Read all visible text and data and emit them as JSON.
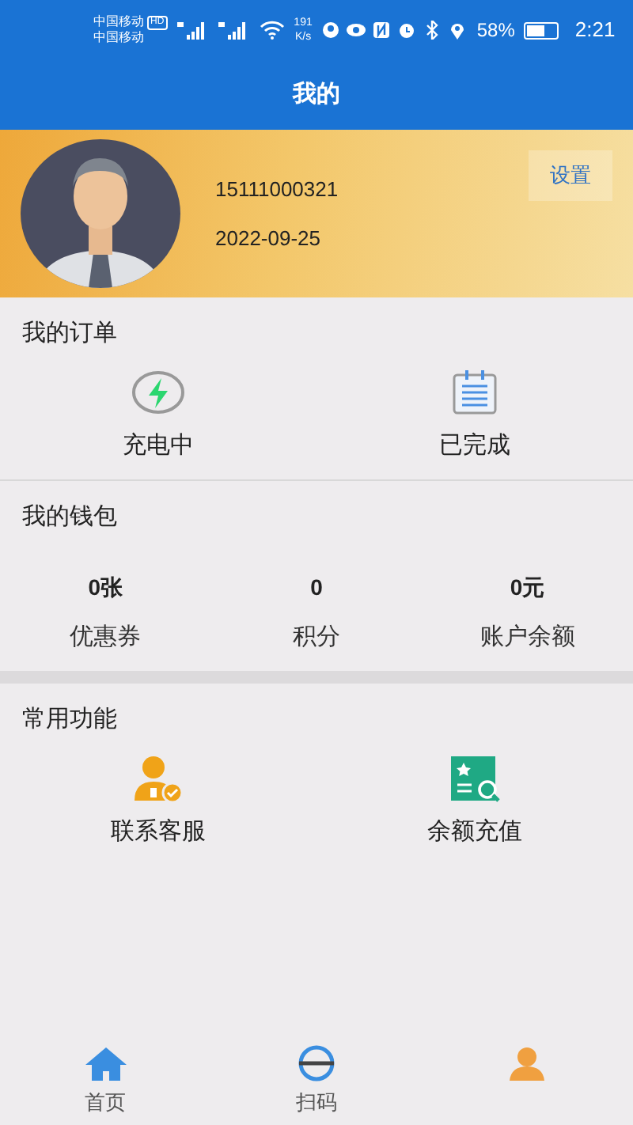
{
  "status_bar": {
    "carrier_1": "中国移动",
    "carrier_1_badge": "HD",
    "carrier_2": "中国移动",
    "speed_value": "191",
    "speed_unit": "K/s",
    "battery": "58%",
    "time": "2:21"
  },
  "header": {
    "title": "我的"
  },
  "profile": {
    "phone": "15111000321",
    "date": "2022-09-25",
    "settings_button": "设置"
  },
  "orders": {
    "title": "我的订单",
    "items": [
      {
        "kind": "charging",
        "label": "充电中"
      },
      {
        "kind": "done",
        "label": "已完成"
      }
    ]
  },
  "wallet": {
    "title": "我的钱包",
    "items": [
      {
        "value": "0张",
        "label": "优惠券"
      },
      {
        "value": "0",
        "label": "积分"
      },
      {
        "value": "0元",
        "label": "账户余额"
      }
    ]
  },
  "functions": {
    "title": "常用功能",
    "items": [
      {
        "kind": "service",
        "label": "联系客服"
      },
      {
        "kind": "recharge",
        "label": "余额充值"
      }
    ]
  },
  "tab_bar": [
    {
      "kind": "home",
      "label": "首页",
      "selected": false
    },
    {
      "kind": "scan",
      "label": "扫码",
      "selected": false
    },
    {
      "kind": "profile",
      "selected": true
    }
  ]
}
